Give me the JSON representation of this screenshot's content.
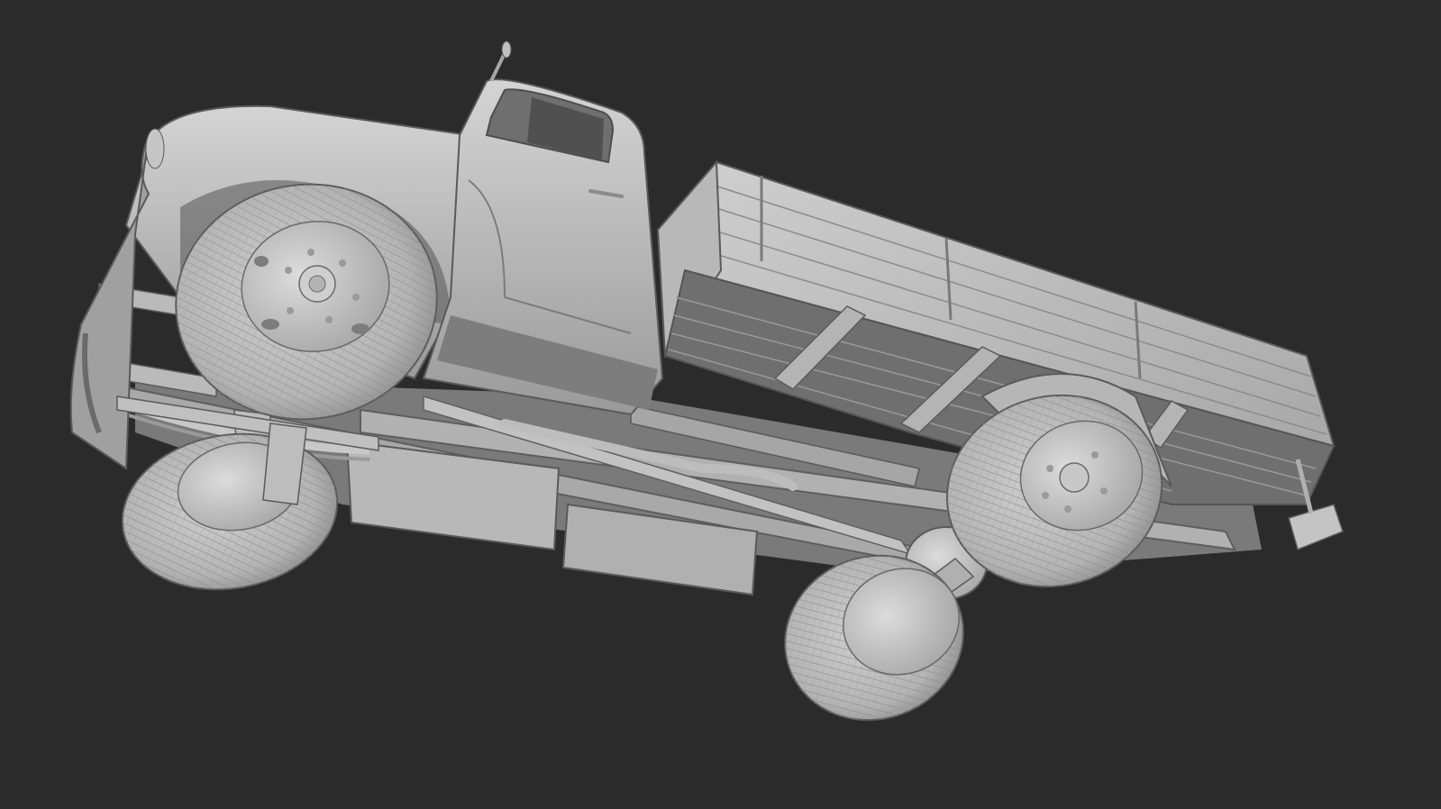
{
  "scene": {
    "background_color": "#2b2b2b",
    "model_color": "#bdbdbd",
    "shadow_color": "#6e6e6e",
    "highlight_color": "#d8d8d8",
    "subject": "truck-3d-model-underside-view"
  }
}
